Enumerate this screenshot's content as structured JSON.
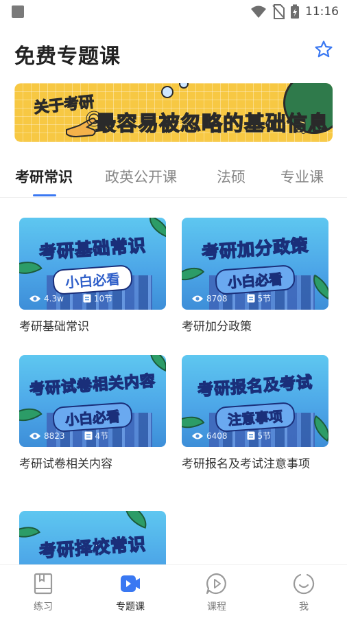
{
  "status_bar": {
    "time": "11:16"
  },
  "header": {
    "title": "免费专题课",
    "star_icon": "star-outline-icon"
  },
  "banner": {
    "tag": "关于考研",
    "headline": "最容易被忽略的基础信息"
  },
  "tabs": [
    {
      "label": "考研常识",
      "active": true
    },
    {
      "label": "政英公开课",
      "active": false
    },
    {
      "label": "法硕",
      "active": false
    },
    {
      "label": "专业课",
      "active": false
    }
  ],
  "courses": [
    {
      "thumb_title": "考研基础常识",
      "thumb_sub": "小白必看",
      "views": "4.3w",
      "lessons": "10节",
      "title": "考研基础常识"
    },
    {
      "thumb_title": "考研加分政策",
      "thumb_sub": "小白必看",
      "views": "8708",
      "lessons": "5节",
      "title": "考研加分政策"
    },
    {
      "thumb_title": "考研试卷相关内容",
      "thumb_sub": "小白必看",
      "views": "8823",
      "lessons": "4节",
      "title": "考研试卷相关内容"
    },
    {
      "thumb_title": "考研报名及考试",
      "thumb_sub": "注意事项",
      "views": "6408",
      "lessons": "5节",
      "title": "考研报名及考试注意事项"
    },
    {
      "thumb_title": "考研择校常识",
      "thumb_sub": "",
      "views": "",
      "lessons": "",
      "title": ""
    }
  ],
  "bottom_nav": [
    {
      "label": "练习",
      "icon": "book-icon",
      "active": false
    },
    {
      "label": "专题课",
      "icon": "video-camera-icon",
      "active": true
    },
    {
      "label": "课程",
      "icon": "play-bubble-icon",
      "active": false
    },
    {
      "label": "我",
      "icon": "smile-face-icon",
      "active": false
    }
  ],
  "colors": {
    "accent": "#3a78f2",
    "banner_bg": "#f7c843",
    "thumb_bg": "#4da7e8"
  }
}
